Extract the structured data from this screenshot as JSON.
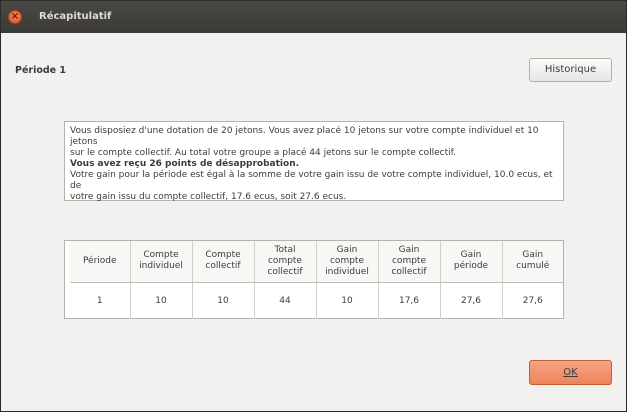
{
  "window": {
    "title": "Récapitulatif",
    "close_icon": "×"
  },
  "period_label": "Période 1",
  "historique_label": "Historique",
  "info": {
    "line1": "Vous disposiez d'une dotation de 20 jetons. Vous avez placé 10 jetons sur votre compte individuel et 10 jetons",
    "line2": "sur le compte collectif. Au total votre groupe a placé 44 jetons sur le compte collectif.",
    "line3": "Vous avez reçu 26 points de désapprobation.",
    "line4": "Votre gain pour la période est égal à la somme de votre gain issu de votre compte individuel, 10.0 ecus, et de",
    "line5": "votre gain issu du compte collectif, 17.6 ecus, soit 27.6 ecus."
  },
  "table": {
    "headers": [
      [
        "Période"
      ],
      [
        "Compte",
        "individuel"
      ],
      [
        "Compte",
        "collectif"
      ],
      [
        "Total",
        "compte",
        "collectif"
      ],
      [
        "Gain",
        "compte",
        "individuel"
      ],
      [
        "Gain",
        "compte",
        "collectif"
      ],
      [
        "Gain",
        "période"
      ],
      [
        "Gain",
        "cumulé"
      ]
    ],
    "rows": [
      [
        "1",
        "10",
        "10",
        "44",
        "10",
        "17,6",
        "27,6",
        "27,6"
      ]
    ]
  },
  "ok_label": "OK"
}
